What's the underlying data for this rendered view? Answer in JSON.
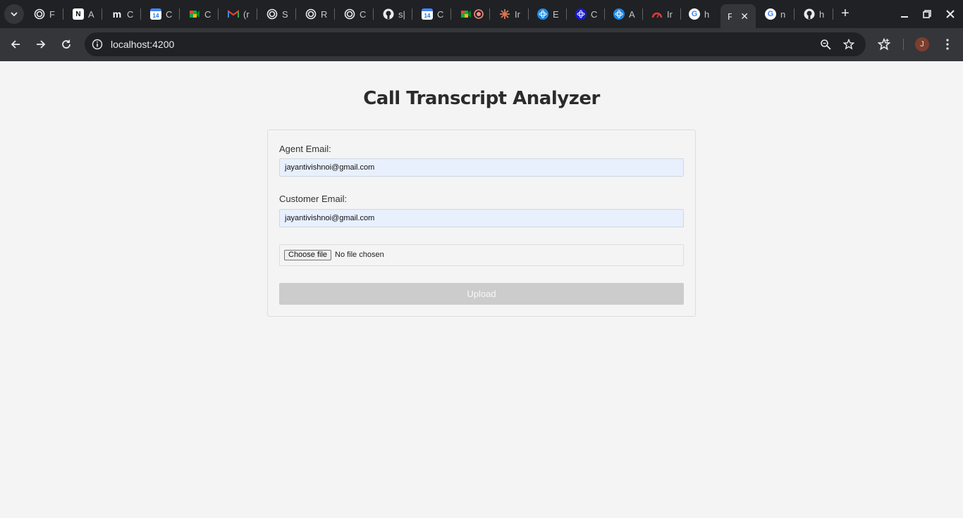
{
  "browser": {
    "tabs": [
      {
        "title": "F",
        "icon": "openai-icon"
      },
      {
        "title": "A",
        "icon": "notion-icon"
      },
      {
        "title": "C",
        "icon": "medium-icon"
      },
      {
        "title": "C",
        "icon": "calendar-icon"
      },
      {
        "title": "C",
        "icon": "meet-icon"
      },
      {
        "title": "(r",
        "icon": "gmail-icon"
      },
      {
        "title": "S",
        "icon": "openai-icon"
      },
      {
        "title": "R",
        "icon": "openai-icon"
      },
      {
        "title": "C",
        "icon": "openai-icon"
      },
      {
        "title": "s|",
        "icon": "github-icon"
      },
      {
        "title": "C",
        "icon": "calendar-icon"
      },
      {
        "title": "",
        "icon": "meet-record-icon"
      },
      {
        "title": "Ir",
        "icon": "claude-icon"
      },
      {
        "title": "E",
        "icon": "react-icon"
      },
      {
        "title": "C",
        "icon": "react-dark-icon"
      },
      {
        "title": "A",
        "icon": "react-icon"
      },
      {
        "title": "Ir",
        "icon": "speed-icon"
      },
      {
        "title": "h",
        "icon": "google-icon"
      }
    ],
    "active_tab": {
      "title": "F"
    },
    "trailing_tabs": [
      {
        "title": "n",
        "icon": "google-icon"
      },
      {
        "title": "h",
        "icon": "github-icon"
      }
    ],
    "url": "localhost:4200",
    "profile_initial": "J"
  },
  "page": {
    "title": "Call Transcript Analyzer",
    "agent_email": {
      "label": "Agent Email:",
      "value": "jayantivishnoi@gmail.com"
    },
    "customer_email": {
      "label": "Customer Email:",
      "value": "jayantivishnoi@gmail.com"
    },
    "file_input": {
      "button_label": "Choose file",
      "status": "No file chosen"
    },
    "upload_label": "Upload"
  }
}
